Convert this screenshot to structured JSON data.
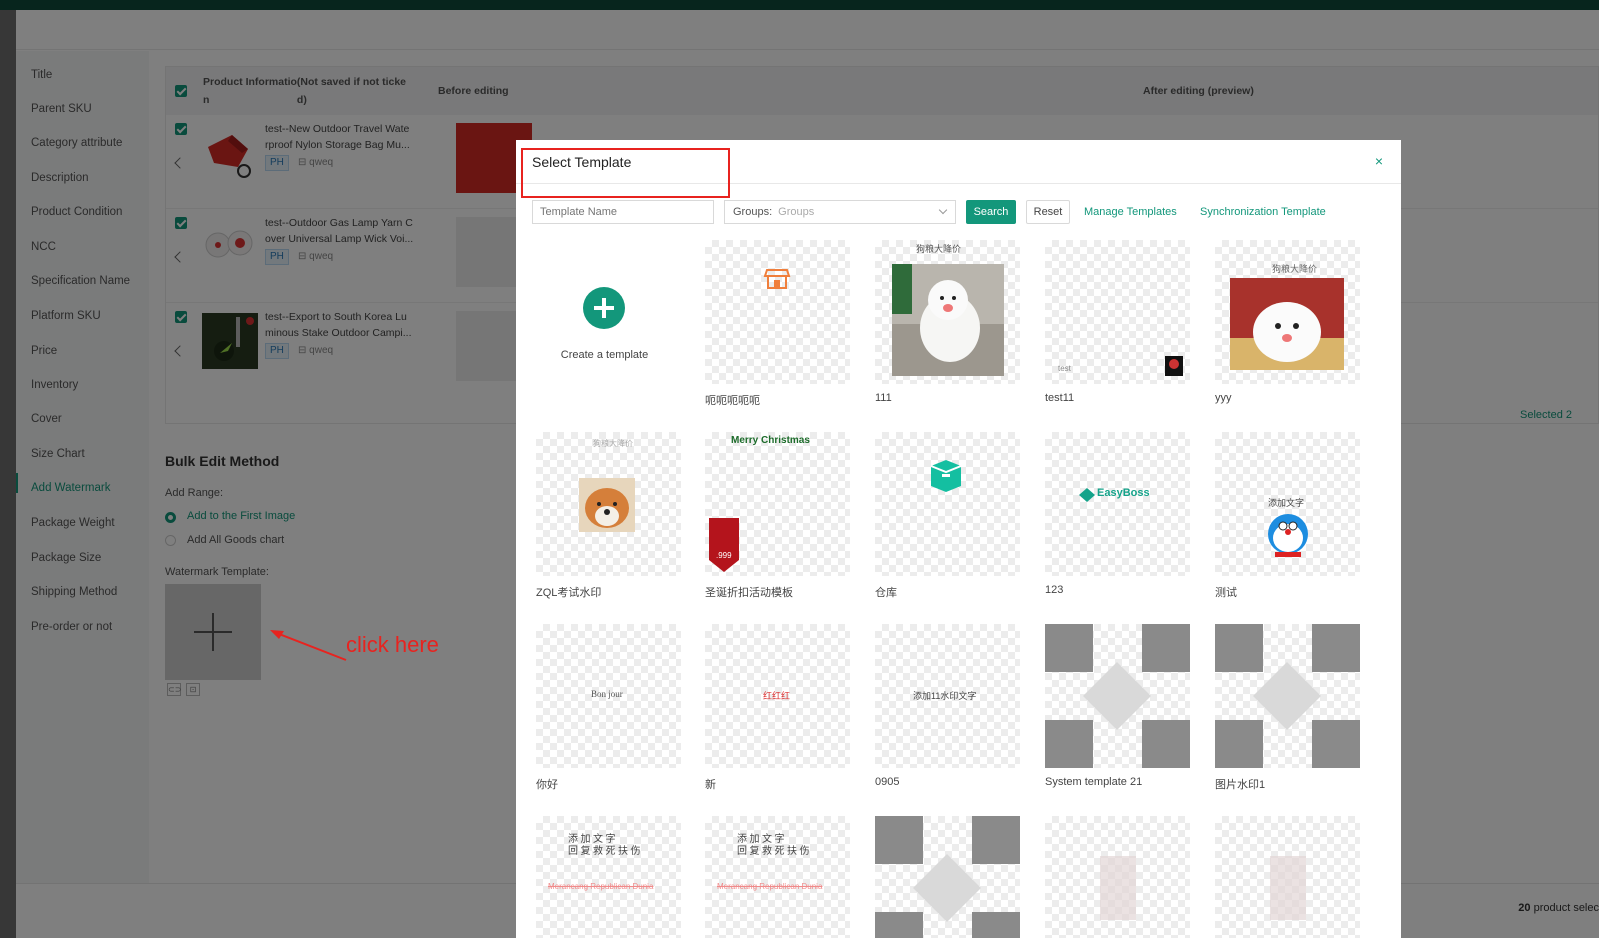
{
  "sidebar": {
    "items": [
      {
        "label": "Title"
      },
      {
        "label": "Parent SKU"
      },
      {
        "label": "Category attribute"
      },
      {
        "label": "Description"
      },
      {
        "label": "Product Condition"
      },
      {
        "label": "NCC"
      },
      {
        "label": "Specification Name"
      },
      {
        "label": "Platform SKU"
      },
      {
        "label": "Price"
      },
      {
        "label": "Inventory"
      },
      {
        "label": "Cover"
      },
      {
        "label": "Size Chart"
      },
      {
        "label": "Add Watermark"
      },
      {
        "label": "Package Weight"
      },
      {
        "label": "Package Size"
      },
      {
        "label": "Shipping Method"
      },
      {
        "label": "Pre-order or not"
      }
    ],
    "active": "Add Watermark"
  },
  "table": {
    "headers": {
      "product_info_line1": "Product Informatio(Not saved if not ticke",
      "product_info_line2": "n                              d)",
      "before": "Before editing",
      "after": "After editing (preview)"
    },
    "rows": [
      {
        "name": "test--New Outdoor Travel Waterproof Nylon Storage Bag Mu...",
        "line1": "test--New Outdoor Travel Wate",
        "line2": "rproof Nylon Storage Bag Mu...",
        "tag": "PH",
        "shop": "qweq"
      },
      {
        "name": "test--Outdoor Gas Lamp Yarn Cover Universal Lamp Wick Voi...",
        "line1": "test--Outdoor Gas Lamp Yarn C",
        "line2": "over Universal Lamp Wick Voi...",
        "tag": "PH",
        "shop": "qweq"
      },
      {
        "name": "test--Export to South Korea Luminous Stake Outdoor Campi...",
        "line1": "test--Export to South Korea Lu",
        "line2": "minous Stake Outdoor Campi...",
        "tag": "PH",
        "shop": "qweq"
      }
    ],
    "selected_link": "Selected 2"
  },
  "bulk": {
    "title": "Bulk Edit Method",
    "add_range_label": "Add Range:",
    "option_first": "Add to the First Image",
    "option_all": "Add All Goods chart",
    "watermark_label": "Watermark Template:"
  },
  "annotation": {
    "click_here": "click here"
  },
  "footer": {
    "count": "20",
    "text": " product selec"
  },
  "modal": {
    "title": "Select Template",
    "close": "×",
    "template_name_placeholder": "Template Name",
    "groups_label": "Groups:",
    "groups_placeholder": "Groups",
    "search_label": "Search",
    "reset_label": "Reset",
    "manage_link": "Manage Templates",
    "sync_link": "Synchronization Template",
    "create_label": "Create a template",
    "templates": [
      {
        "name": "呃呃呃呃呃"
      },
      {
        "name": "111",
        "overlay_text": "狗粮大降价"
      },
      {
        "name": "test11",
        "overlay_text": "test"
      },
      {
        "name": "yyy",
        "overlay_text": "狗粮大降价"
      },
      {
        "name": "ZQL考试水印",
        "overlay_text": "狗粮大降价"
      },
      {
        "name": "圣诞折扣活动模板",
        "overlay_text": "Merry Christmas",
        "badge_text": ".999"
      },
      {
        "name": "仓库"
      },
      {
        "name": "123",
        "overlay_text": "EasyBoss"
      },
      {
        "name": "测试",
        "overlay_text": "添加文字"
      },
      {
        "name": "你好",
        "overlay_text": "Bon jour"
      },
      {
        "name": "新",
        "overlay_text": "红红红"
      },
      {
        "name": "0905",
        "overlay_text": "添加11水印文字"
      },
      {
        "name": "System template 21"
      },
      {
        "name": "图片水印1"
      },
      {
        "name": "",
        "overlay_text": "添 加 文 字",
        "overlay_text2": "回 复 救 死 扶 伤",
        "overlay_text3": "Merancang Republican Dunia"
      },
      {
        "name": "",
        "overlay_text": "添 加 文 字",
        "overlay_text2": "回 复 救 死 扶 伤",
        "overlay_text3": "Merancang Republican Dunia"
      },
      {
        "name": ""
      },
      {
        "name": ""
      },
      {
        "name": ""
      }
    ]
  },
  "colors": {
    "accent": "#13977b",
    "annotation_red": "#e8231f",
    "topbar": "#0f4a3a"
  }
}
